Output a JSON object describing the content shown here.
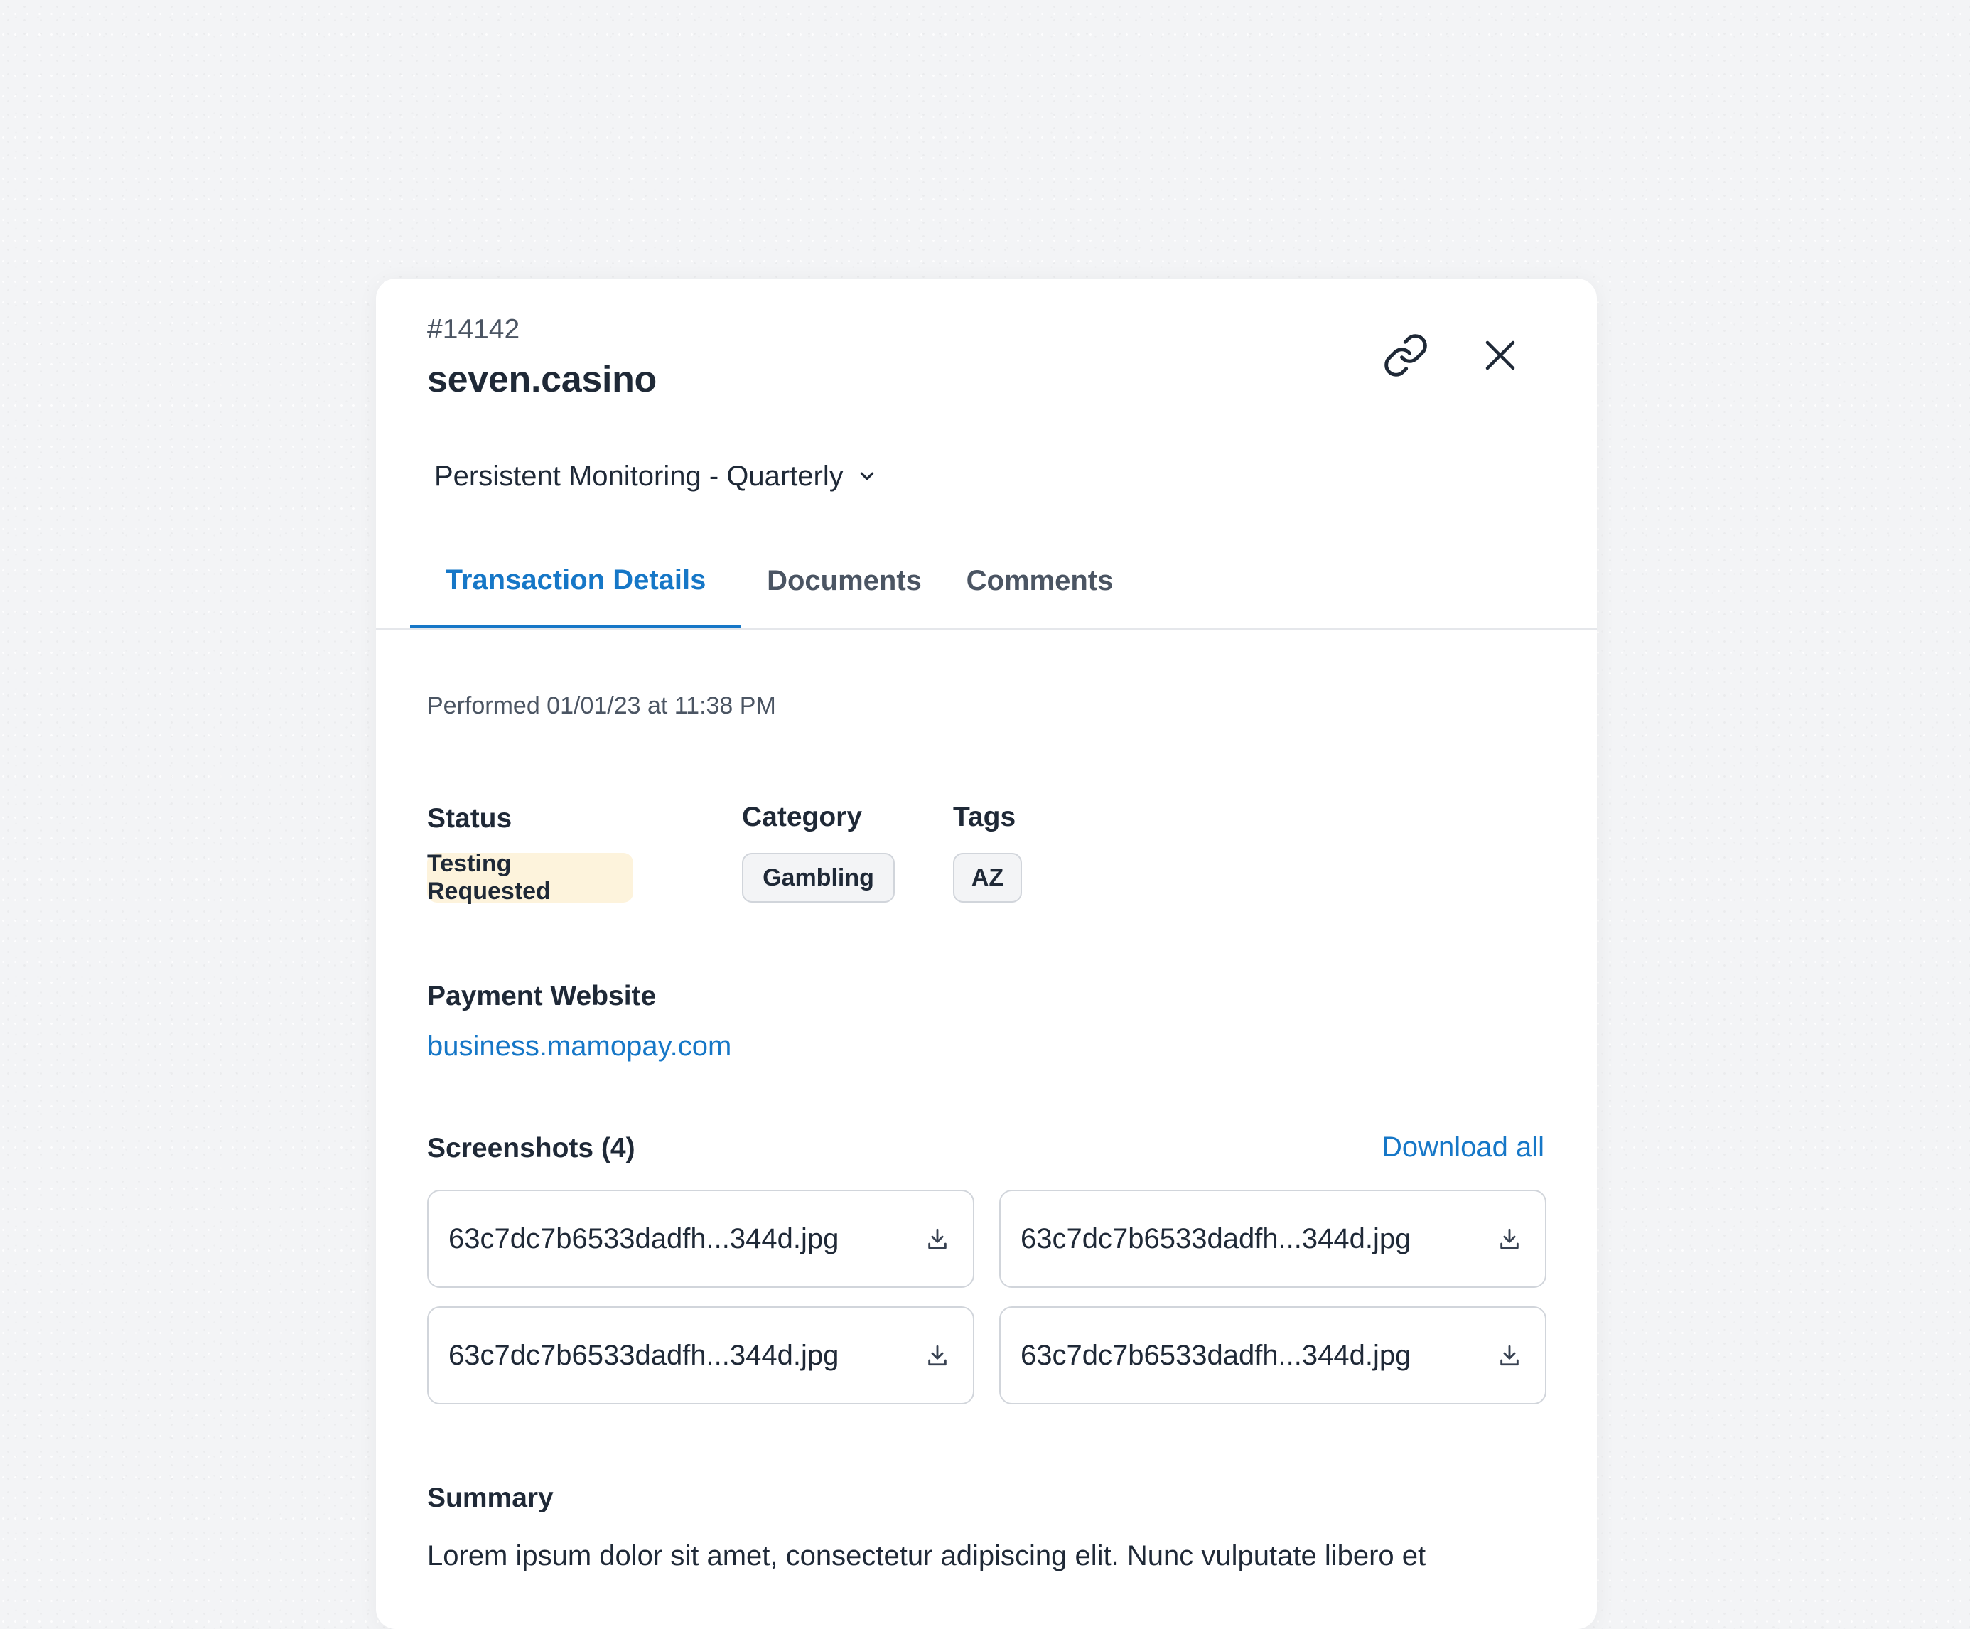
{
  "header": {
    "transaction_id": "#14142",
    "merchant_name": "seven.casino",
    "copy_link_icon": "link-icon",
    "close_icon": "close-icon"
  },
  "monitoring_selector": {
    "value": "Persistent Monitoring - Quarterly",
    "icon": "chevron-down-icon"
  },
  "tabs": [
    {
      "label": "Transaction Details",
      "active": true
    },
    {
      "label": "Documents",
      "active": false
    },
    {
      "label": "Comments",
      "active": false
    }
  ],
  "details": {
    "performed": "Performed 01/01/23 at 11:38 PM",
    "status": {
      "label": "Status",
      "value": "Testing Requested",
      "color": "#fdf3dc"
    },
    "category": {
      "label": "Category",
      "value": "Gambling"
    },
    "tags": {
      "label": "Tags",
      "values": [
        "AZ"
      ]
    },
    "payment_website": {
      "label": "Payment Website",
      "value": "business.mamopay.com"
    }
  },
  "screenshots": {
    "label": "Screenshots (4)",
    "download_all": "Download all",
    "files": [
      "63c7dc7b6533dadfh...344d.jpg",
      "63c7dc7b6533dadfh...344d.jpg",
      "63c7dc7b6533dadfh...344d.jpg",
      "63c7dc7b6533dadfh...344d.jpg"
    ],
    "file_icon": "download-icon"
  },
  "summary": {
    "label": "Summary",
    "text": "Lorem ipsum dolor sit amet, consectetur adipiscing elit. Nunc vulputate libero et"
  },
  "colors": {
    "accent": "#1677c7",
    "text": "#1f2937",
    "muted": "#4b5563",
    "border": "#d1d5db"
  }
}
